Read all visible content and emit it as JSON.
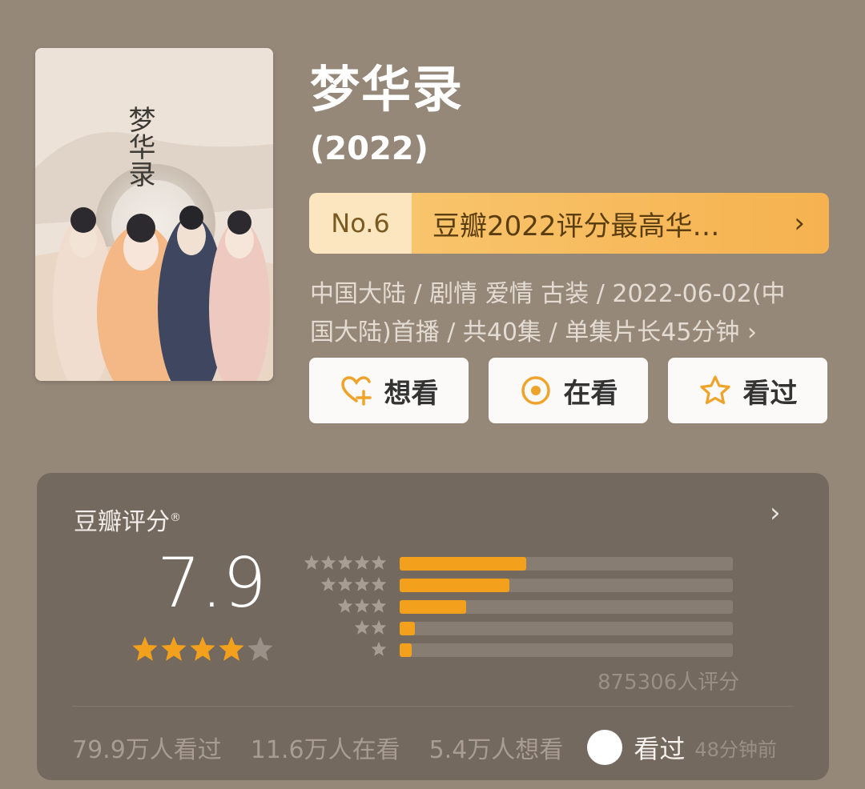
{
  "poster": {
    "calligraphy": "梦华录"
  },
  "movie": {
    "title": "梦华录",
    "year": "(2022)"
  },
  "ranking": {
    "number": "No.6",
    "text": "豆瓣2022评分最高华…"
  },
  "meta": {
    "line1": "中国大陆 / 剧情 爱情 古装 / 2022-06-02(中",
    "line2": "国大陆)首播 / 共40集 / 单集片长45分钟 ›"
  },
  "actions": [
    {
      "label": "想看",
      "icon": "heart-plus-icon"
    },
    {
      "label": "在看",
      "icon": "target-circle-icon"
    },
    {
      "label": "看过",
      "icon": "star-outline-icon"
    }
  ],
  "rating": {
    "label": "豆瓣评分",
    "mark": "®",
    "score": "7.9",
    "star_value": 4,
    "distribution": [
      {
        "stars": 5,
        "fraction": 0.38
      },
      {
        "stars": 4,
        "fraction": 0.33
      },
      {
        "stars": 3,
        "fraction": 0.2
      },
      {
        "stars": 2,
        "fraction": 0.045
      },
      {
        "stars": 1,
        "fraction": 0.035
      }
    ],
    "count_text": "875306人评分"
  },
  "stats": {
    "watched": "79.9万人看过",
    "watching": "11.6万人在看",
    "want": "5.4万人想看",
    "my_status": "看过",
    "time_ago": "48分钟前"
  },
  "colors": {
    "accent": "#f3a01d",
    "background": "#958879",
    "panel": "#74695e"
  }
}
